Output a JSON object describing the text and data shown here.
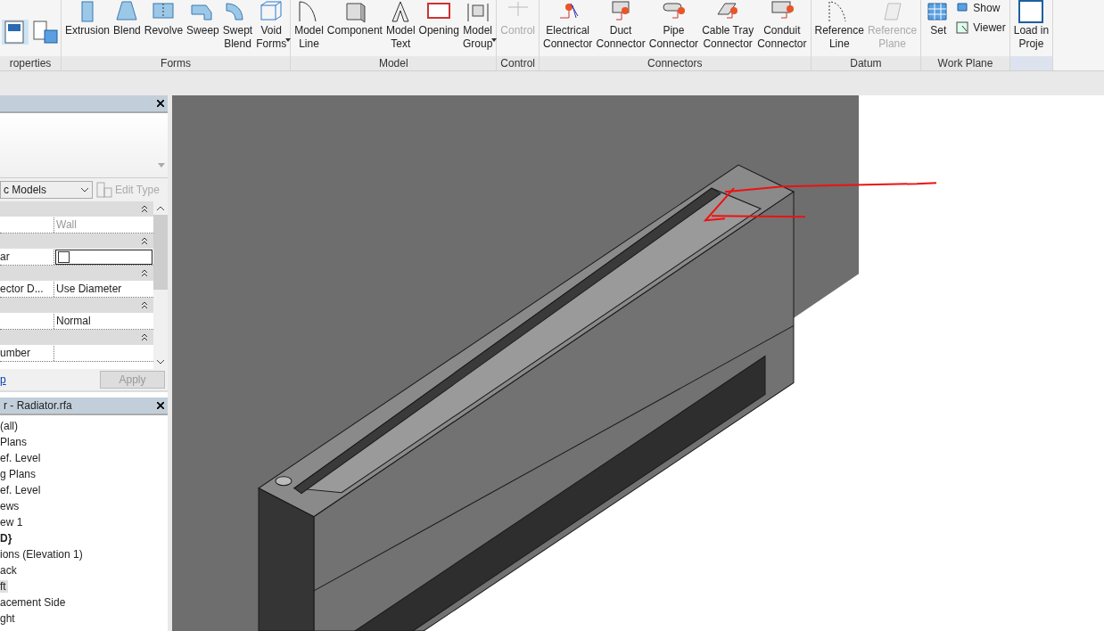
{
  "ribbon": {
    "panels": [
      {
        "label": "roperties"
      },
      {
        "label": "Forms",
        "buttons": [
          {
            "kind": "large",
            "label": "Extrusion",
            "disabled": false,
            "dropdown": false
          },
          {
            "kind": "large",
            "label": "Blend",
            "disabled": false,
            "dropdown": false
          },
          {
            "kind": "large",
            "label": "Revolve",
            "disabled": false,
            "dropdown": false
          },
          {
            "kind": "large",
            "label": "Sweep",
            "disabled": false,
            "dropdown": false
          },
          {
            "kind": "large",
            "label": "Swept\nBlend",
            "disabled": false,
            "dropdown": false
          },
          {
            "kind": "large",
            "label": "Void\nForms",
            "disabled": false,
            "dropdown": true
          }
        ]
      },
      {
        "label": "Model",
        "buttons": [
          {
            "kind": "large",
            "label": "Model\nLine",
            "disabled": false,
            "dropdown": false
          },
          {
            "kind": "large",
            "label": "Component",
            "disabled": false,
            "dropdown": false
          },
          {
            "kind": "large",
            "label": "Model\nText",
            "disabled": false,
            "dropdown": false
          },
          {
            "kind": "large",
            "label": "Opening",
            "disabled": false,
            "dropdown": false
          },
          {
            "kind": "large",
            "label": "Model\nGroup",
            "disabled": false,
            "dropdown": true
          }
        ]
      },
      {
        "label": "Control",
        "buttons": [
          {
            "kind": "large",
            "label": "Control",
            "disabled": true,
            "dropdown": false
          }
        ]
      },
      {
        "label": "Connectors",
        "buttons": [
          {
            "kind": "large",
            "label": "Electrical\nConnector",
            "disabled": false,
            "dropdown": false
          },
          {
            "kind": "large",
            "label": "Duct\nConnector",
            "disabled": false,
            "dropdown": false
          },
          {
            "kind": "large",
            "label": "Pipe\nConnector",
            "disabled": false,
            "dropdown": false
          },
          {
            "kind": "large",
            "label": "Cable Tray\nConnector",
            "disabled": false,
            "dropdown": false
          },
          {
            "kind": "large",
            "label": "Conduit\nConnector",
            "disabled": false,
            "dropdown": false
          }
        ]
      },
      {
        "label": "Datum",
        "buttons": [
          {
            "kind": "large",
            "label": "Reference\nLine",
            "disabled": false,
            "dropdown": false
          },
          {
            "kind": "large",
            "label": "Reference\nPlane",
            "disabled": true,
            "dropdown": false
          }
        ]
      },
      {
        "label": "Work Plane",
        "buttons": [
          {
            "kind": "large",
            "label": "Set",
            "disabled": false,
            "dropdown": false
          },
          {
            "kind": "small",
            "label": "Show",
            "disabled": false
          },
          {
            "kind": "small",
            "label": "Viewer",
            "disabled": false
          }
        ]
      },
      {
        "buttons": [
          {
            "kind": "large",
            "label": "Load in\nProje",
            "disabled": false,
            "dropdown": false
          }
        ]
      }
    ]
  },
  "properties": {
    "type_selector": "c Models",
    "edit_type": {
      "label": "Edit Type",
      "disabled": true
    },
    "rows": [
      {
        "kind": "group"
      },
      {
        "kind": "param",
        "name": "",
        "value": "Wall",
        "disabled": true
      },
      {
        "kind": "group"
      },
      {
        "kind": "checkbox",
        "name": "ar",
        "checked": false
      },
      {
        "kind": "group"
      },
      {
        "kind": "param",
        "name": "ector D...",
        "value": "Use Diameter",
        "disabled": false
      },
      {
        "kind": "group"
      },
      {
        "kind": "param",
        "name": "",
        "value": "Normal",
        "disabled": false
      },
      {
        "kind": "group"
      },
      {
        "kind": "param",
        "name": "umber",
        "value": ""
      }
    ],
    "help_link": "p",
    "apply": {
      "label": "Apply",
      "disabled": true
    }
  },
  "project_browser": {
    "title": "r - Radiator.rfa",
    "items": [
      {
        "label": "(all)",
        "bold": false,
        "selected": false
      },
      {
        "label": "Plans",
        "bold": false,
        "selected": false
      },
      {
        "label": "ef. Level",
        "bold": false,
        "selected": false
      },
      {
        "label": "g Plans",
        "bold": false,
        "selected": false
      },
      {
        "label": "ef. Level",
        "bold": false,
        "selected": false
      },
      {
        "label": "ews",
        "bold": false,
        "selected": false
      },
      {
        "label": "ew 1",
        "bold": false,
        "selected": false
      },
      {
        "label": "D}",
        "bold": true,
        "selected": false
      },
      {
        "label": "ions (Elevation 1)",
        "bold": false,
        "selected": false
      },
      {
        "label": "ack",
        "bold": false,
        "selected": false
      },
      {
        "label": "ft",
        "bold": false,
        "selected": true
      },
      {
        "label": "acement Side",
        "bold": false,
        "selected": false
      },
      {
        "label": "ght",
        "bold": false,
        "selected": false
      }
    ]
  }
}
